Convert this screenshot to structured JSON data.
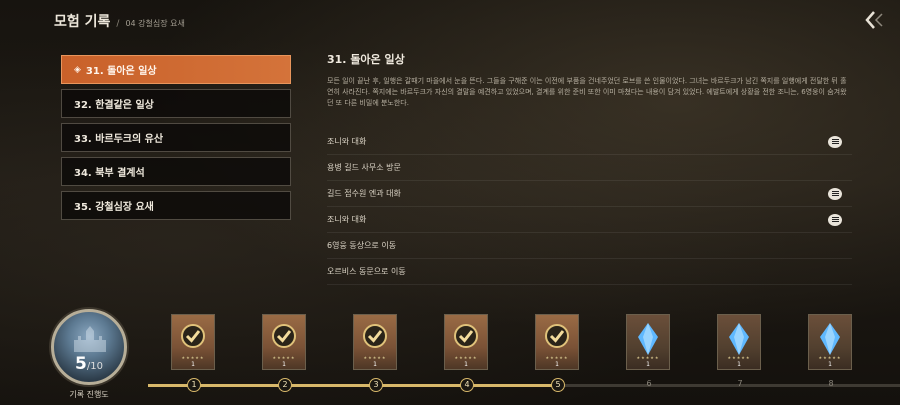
{
  "header": {
    "title": "모험 기록",
    "separator": "/",
    "breadcrumb": "04 강철심장 요새",
    "back_icon": "double-chevron-left-icon"
  },
  "chapters": [
    {
      "label": "31. 돌아온 일상",
      "active": true,
      "marker": "◈"
    },
    {
      "label": "32. 한결같은 일상",
      "active": false
    },
    {
      "label": "33. 바르두크의 유산",
      "active": false
    },
    {
      "label": "34. 북부 결계석",
      "active": false
    },
    {
      "label": "35. 강철심장 요새",
      "active": false
    }
  ],
  "detail": {
    "title": "31. 돌아온 일상",
    "description": "모든 일이 끝난 후, 일행은 갈때기 마을에서 눈을 뜬다. 그들을 구해준 이는 이전에 부품을 건네주었던 로브를 쓴 인물이었다. 그녀는 바르두크가 남긴 쪽지를 일행에게 전달한 뒤 홀연히 사라진다. 쪽지에는 바르두크가 자신의 결말을 예견하고 있었으며, 결계를 위한 준비 또한 이미 마쳤다는 내용이 담겨 있었다. 에발트에게 상황을 전한 조니는, 6영웅이 숨겨왔던 또 다른 비밀에 분노한다."
  },
  "tasks": [
    {
      "label": "조니와 대화",
      "has_chat": true
    },
    {
      "label": "용병 길드 사무소 방문",
      "has_chat": false
    },
    {
      "label": "길드 접수원 엔과 대화",
      "has_chat": true
    },
    {
      "label": "조니와 대화",
      "has_chat": true
    },
    {
      "label": "6영웅 동상으로 이동",
      "has_chat": false
    },
    {
      "label": "오르비스 동문으로 이동",
      "has_chat": false
    }
  ],
  "progress": {
    "current": "5",
    "total": "/10",
    "label": "기록 진행도",
    "fraction": 0.5
  },
  "rewards": [
    {
      "node": "1",
      "type": "claimed-check",
      "qty": "1",
      "done": true
    },
    {
      "node": "2",
      "type": "claimed-check",
      "qty": "1",
      "done": true
    },
    {
      "node": "3",
      "type": "claimed-check",
      "qty": "1",
      "done": true
    },
    {
      "node": "4",
      "type": "claimed-check",
      "qty": "1",
      "done": true
    },
    {
      "node": "5",
      "type": "claimed-check",
      "qty": "1",
      "done": true
    },
    {
      "node": "6",
      "type": "blue-crystal",
      "qty": "1",
      "done": false
    },
    {
      "node": "7",
      "type": "blue-crystal",
      "qty": "1",
      "done": false
    },
    {
      "node": "8",
      "type": "blue-crystal",
      "qty": "1",
      "done": false
    }
  ],
  "colors": {
    "active_chapter": "#d06a30",
    "track_fill": "#d8b86a",
    "crystal": "#5fb8ff"
  }
}
